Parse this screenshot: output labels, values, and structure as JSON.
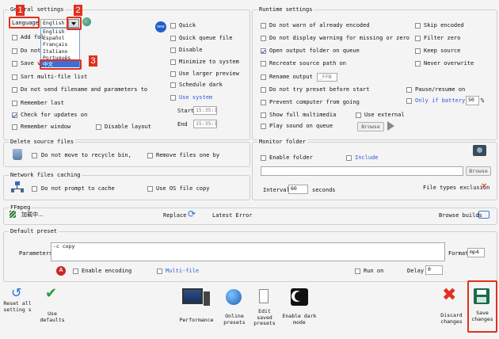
{
  "general": {
    "title": "General settings",
    "language_label": "Language",
    "language_value": "English",
    "language_options": [
      "English",
      "Español",
      "Français",
      "Italiano",
      "Português",
      "中文"
    ],
    "add_folder": "Add fol",
    "do_not": "Do not",
    "save": "Save v",
    "sort_multi": "Sort multi-file list",
    "do_not_send": "Do not send filename and parameters to",
    "remember_last": "Remember last",
    "check_updates": "Check for updates on",
    "remember_window": "Remember window",
    "disable_layout": "Disable layout",
    "new_badge": "new",
    "quick": "Quick",
    "quick_queue": "Quick queue file",
    "disable": "Disable",
    "minimize": "Minimize to system",
    "larger_preview": "Use larger preview",
    "schedule_dark": "Schedule dark",
    "use_system": "Use system",
    "start_label": "Start",
    "start_time": "15:35:1",
    "end_label": "End",
    "end_time": "15:35:1"
  },
  "runtime": {
    "title": "Runtime settings",
    "no_warn_already": "Do not warn of already encoded",
    "no_warning_missing": "Do not display warning for missing or zero",
    "open_output": "Open output folder on queue",
    "recreate_source": "Recreate source path on",
    "rename_output": "Rename output",
    "rename_value": "_FFB",
    "no_try_preset": "Do not try preset before start",
    "prevent_computer": "Prevent computer from going",
    "show_full_multimedia": "Show full multimedia",
    "use_external": "Use external",
    "play_sound": "Play sound on queue",
    "browse": "Browse",
    "skip_encoded": "Skip encoded",
    "filter_zero": "Filter zero",
    "keep_source": "Keep source",
    "never_overwrite": "Never overwrite",
    "pause_resume": "Pause/resume on",
    "only_battery": "Only if battery",
    "battery_value": "50",
    "percent": "%"
  },
  "delete": {
    "title": "Delete source files",
    "no_recycle": "Do not move to recycle bin,",
    "remove_one": "Remove files one by"
  },
  "monitor": {
    "title": "Monitor folder",
    "enable_folder": "Enable folder",
    "include": "Include",
    "browse": "Browse",
    "interval_label": "Interval",
    "interval_value": "60",
    "seconds": "seconds",
    "file_types": "File types exclusion"
  },
  "network": {
    "title": "Network files caching",
    "no_prompt": "Do not prompt to cache",
    "use_os": "Use OS file copy"
  },
  "ffmpeg": {
    "title": "FFmpeg",
    "loading": "加载中...",
    "replace": "Replace",
    "latest_error": "Latest Error",
    "browse_builds": "Browse builds"
  },
  "preset": {
    "title": "Default preset",
    "parameters_label": "Parameters",
    "parameters_value": "-c copy",
    "format_label": "Format",
    "format_value": "mp4",
    "enable_encoding": "Enable encoding",
    "multi_file": "Multi-file",
    "run_on": "Run on",
    "delay_label": "Delay",
    "delay_value": "0"
  },
  "toolbar": {
    "reset": "Reset all setting s",
    "use_defaults": "Use defaults",
    "performance": "Performance",
    "online_presets": "Online presets",
    "edit_saved": "Edit saved presets",
    "enable_dark": "Enable dark mode",
    "discard": "Discard changes",
    "save": "Save changes"
  },
  "annotations": {
    "tag1": "1",
    "tag2": "2",
    "tag3": "3"
  },
  "colors": {
    "annotation_red": "#e0301e",
    "link_blue": "#2a5bd7"
  }
}
